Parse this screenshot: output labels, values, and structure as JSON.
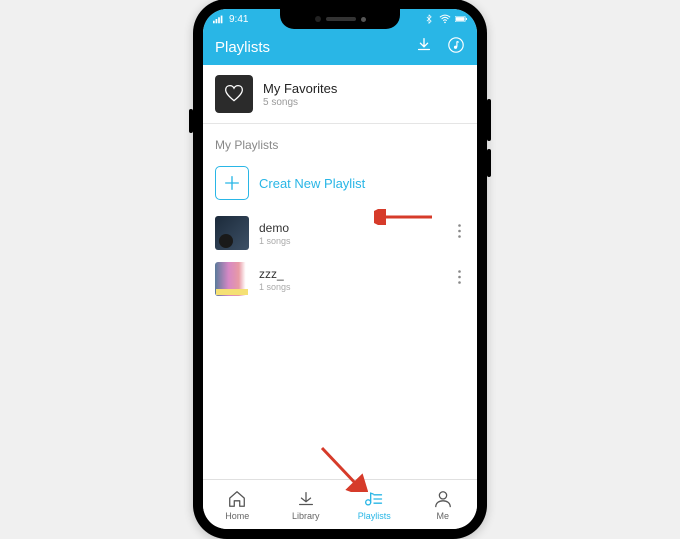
{
  "statusbar": {
    "time": "9:41"
  },
  "header": {
    "title": "Playlists"
  },
  "favorites": {
    "title": "My Favorites",
    "subtitle": "5 songs"
  },
  "section": {
    "my_playlists": "My Playlists"
  },
  "create": {
    "label": "Creat New Playlist"
  },
  "playlists": [
    {
      "title": "demo",
      "subtitle": "1 songs"
    },
    {
      "title": "zzz_",
      "subtitle": "1 songs"
    }
  ],
  "tabs": {
    "home": "Home",
    "library": "Library",
    "playlists": "Playlists",
    "me": "Me"
  },
  "colors": {
    "accent": "#29b6e6"
  }
}
